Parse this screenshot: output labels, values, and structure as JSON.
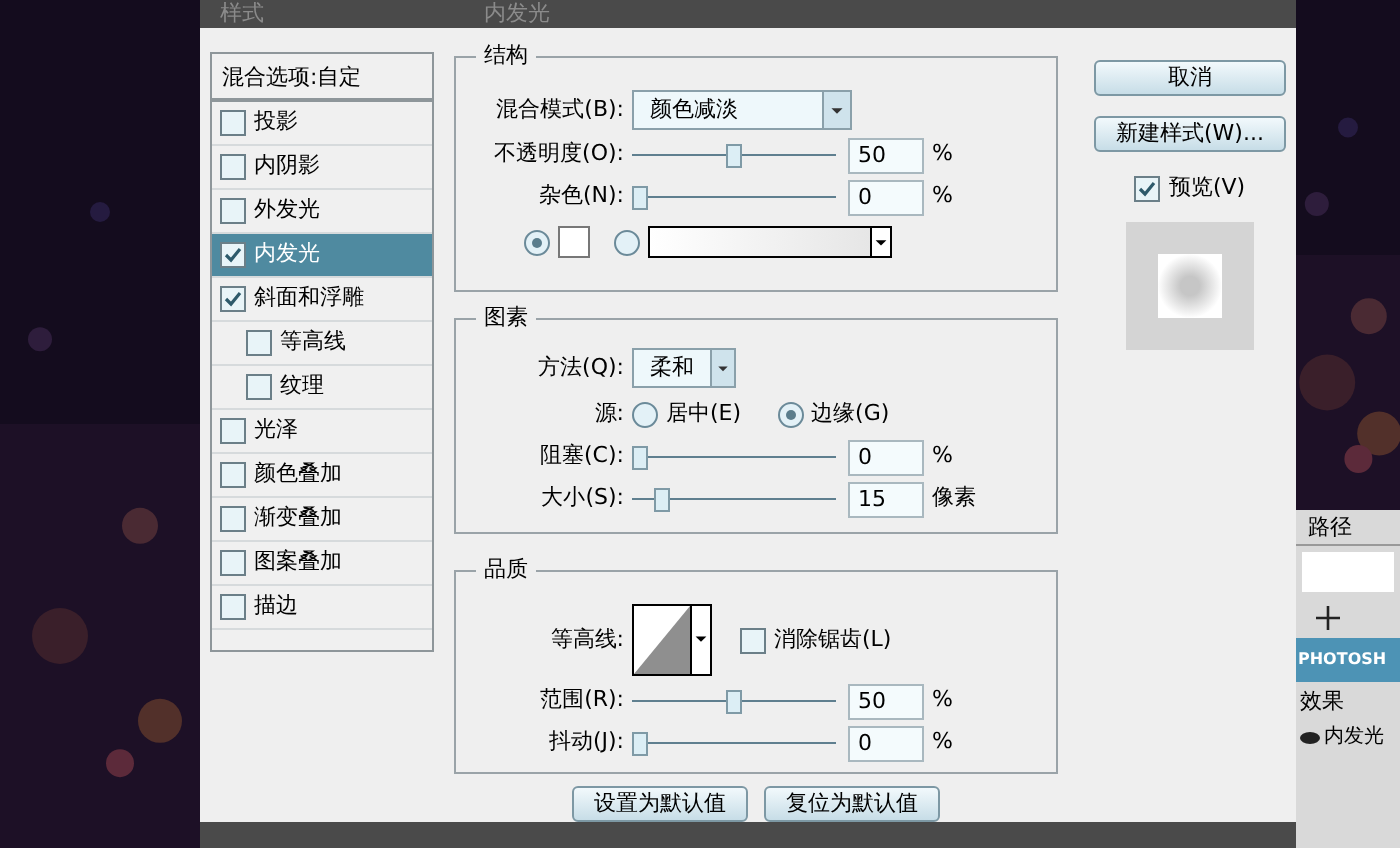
{
  "dialog": {
    "styles_title": "样式",
    "panel_title": "内发光"
  },
  "styles_panel": {
    "header": "混合选项:自定",
    "items": [
      {
        "label": "投影",
        "checked": false,
        "selected": false
      },
      {
        "label": "内阴影",
        "checked": false,
        "selected": false
      },
      {
        "label": "外发光",
        "checked": false,
        "selected": false
      },
      {
        "label": "内发光",
        "checked": true,
        "selected": true
      },
      {
        "label": "斜面和浮雕",
        "checked": true,
        "selected": false,
        "children": [
          {
            "label": "等高线",
            "checked": false,
            "selected": false
          },
          {
            "label": "纹理",
            "checked": false,
            "selected": false
          }
        ]
      },
      {
        "label": "光泽",
        "checked": false,
        "selected": false
      },
      {
        "label": "颜色叠加",
        "checked": false,
        "selected": false
      },
      {
        "label": "渐变叠加",
        "checked": false,
        "selected": false
      },
      {
        "label": "图案叠加",
        "checked": false,
        "selected": false
      },
      {
        "label": "描边",
        "checked": false,
        "selected": false
      }
    ]
  },
  "structure": {
    "title": "结构",
    "blend_mode": {
      "label": "混合模式(B):",
      "value": "颜色减淡"
    },
    "sliders": [
      {
        "label": "不透明度(O):",
        "level": 0.5,
        "value": "50",
        "unit": "%"
      },
      {
        "label": "杂色(N):",
        "level": 0,
        "value": "0",
        "unit": "%"
      }
    ],
    "fill": [
      {
        "kind": "color",
        "selected": true
      },
      {
        "kind": "gradient",
        "selected": false
      }
    ]
  },
  "elements": {
    "title": "图素",
    "technique": {
      "label": "方法(Q):",
      "value": "柔和"
    },
    "source": {
      "label": "源:",
      "options": [
        {
          "label": "居中(E)",
          "selected": false
        },
        {
          "label": "边缘(G)",
          "selected": true
        }
      ]
    },
    "sliders": [
      {
        "label": "阻塞(C):",
        "level": 0,
        "value": "0",
        "unit": "%"
      },
      {
        "label": "大小(S):",
        "level": 0.12,
        "value": "15",
        "unit": "像素"
      }
    ]
  },
  "quality": {
    "title": "品质",
    "contour": {
      "label": "等高线:"
    },
    "anti_alias": {
      "label": "消除锯齿(L)",
      "checked": false
    },
    "sliders": [
      {
        "label": "范围(R):",
        "level": 0.5,
        "value": "50",
        "unit": "%"
      },
      {
        "label": "抖动(J):",
        "level": 0,
        "value": "0",
        "unit": "%"
      }
    ]
  },
  "footer_buttons": [
    "设置为默认值",
    "复位为默认值"
  ],
  "side": {
    "buttons": [
      "取消",
      "新建样式(W)..."
    ],
    "preview": {
      "label": "预览(V)",
      "checked": true
    }
  },
  "layers_panel": {
    "tab": "路径",
    "layer": "PHOTOSH",
    "effects": "效果",
    "effect": "内发光"
  }
}
